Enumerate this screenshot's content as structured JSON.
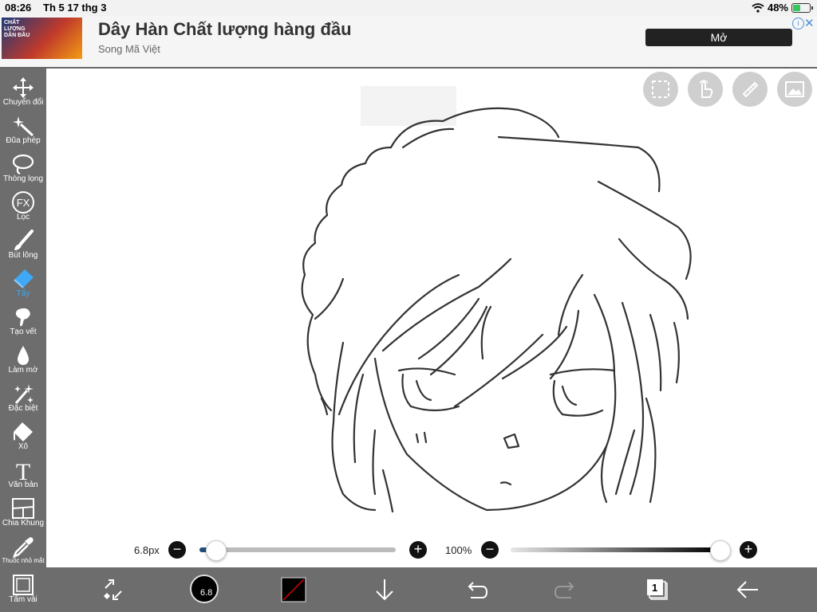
{
  "status": {
    "time": "08:26",
    "date": "Th 5 17 thg 3",
    "battery": "48%"
  },
  "ad": {
    "thumb_text": "CHẤT LƯỢNG DẪN ĐẦU",
    "title": "Dây Hàn Chất lượng hàng đầu",
    "subtitle": "Song Mã Việt",
    "button": "Mở",
    "info": "i",
    "close": "✕"
  },
  "tools": [
    {
      "label": "Chuyển đổi",
      "icon": "move-icon"
    },
    {
      "label": "Đũa phép",
      "icon": "magic-wand-icon"
    },
    {
      "label": "Thòng lọng",
      "icon": "lasso-icon"
    },
    {
      "label": "Lọc",
      "icon": "fx-icon"
    },
    {
      "label": "Bút lông",
      "icon": "brush-icon"
    },
    {
      "label": "Tẩy",
      "icon": "eraser-icon",
      "active": true
    },
    {
      "label": "Tạo vết",
      "icon": "smudge-icon"
    },
    {
      "label": "Làm mờ",
      "icon": "blur-drop-icon"
    },
    {
      "label": "Đặc biệt",
      "icon": "special-icon"
    },
    {
      "label": "Xô",
      "icon": "bucket-icon"
    },
    {
      "label": "Văn bản",
      "icon": "text-icon"
    },
    {
      "label": "Chia Khung",
      "icon": "frame-divider-icon"
    },
    {
      "label": "Thuốc nhỏ mắt",
      "icon": "eyedropper-icon"
    },
    {
      "label": "Tấm vải",
      "icon": "canvas-icon"
    }
  ],
  "fx_text": "FX",
  "text_tool_glyph": "T",
  "size_slider": {
    "value": "6.8px",
    "minus": "−",
    "plus": "+",
    "level": 0.08
  },
  "opacity_slider": {
    "value": "100%",
    "minus": "−",
    "plus": "+",
    "level": 1.0
  },
  "bottom": {
    "brush_size": "6.8",
    "layers_count": "1"
  },
  "colors": {
    "toolbar": "#6d6d6d",
    "accent": "#3fa9f5",
    "track_fill": "#1f4e79"
  }
}
